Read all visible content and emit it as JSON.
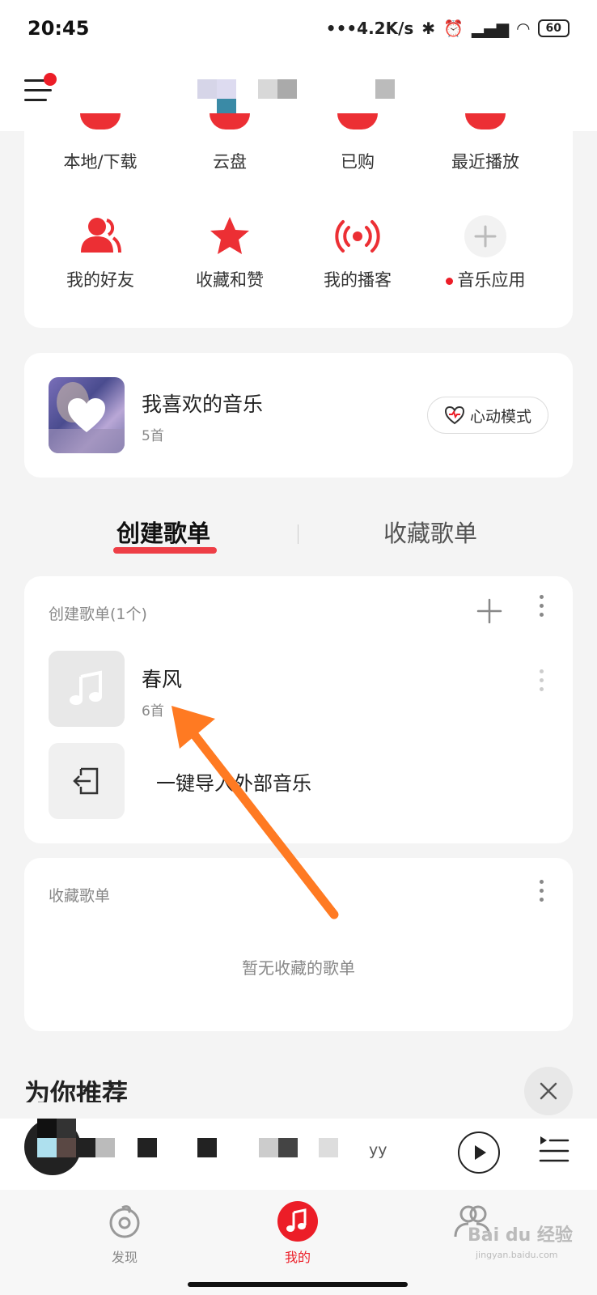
{
  "status": {
    "time": "20:45",
    "network_speed": "•••4.2K/s",
    "battery": "60"
  },
  "quick_grid": {
    "row1": [
      "本地/下载",
      "云盘",
      "已购",
      "最近播放"
    ],
    "row2": [
      "我的好友",
      "收藏和赞",
      "我的播客",
      "音乐应用"
    ]
  },
  "favorite": {
    "title": "我喜欢的音乐",
    "count": "5首",
    "mode_button": "心动模式"
  },
  "tabs": {
    "created": "创建歌单",
    "collected": "收藏歌单"
  },
  "created_section": {
    "header": "创建歌单(1个)",
    "playlists": [
      {
        "name": "春风",
        "count": "6首"
      }
    ],
    "import_label": "一键导入外部音乐"
  },
  "collected_section": {
    "header": "收藏歌单",
    "empty_text": "暂无收藏的歌单"
  },
  "recommend": {
    "title": "为你推荐"
  },
  "mini_player": {
    "text": "yy"
  },
  "bottom_nav": {
    "discover": "发现",
    "mine": "我的",
    "community": "Bai du 经验"
  },
  "watermark": {
    "text": "Bai du 经验",
    "sub": "jingyan.baidu.com"
  },
  "colors": {
    "accent": "#ec1d27",
    "arrow": "#ff7a22"
  }
}
